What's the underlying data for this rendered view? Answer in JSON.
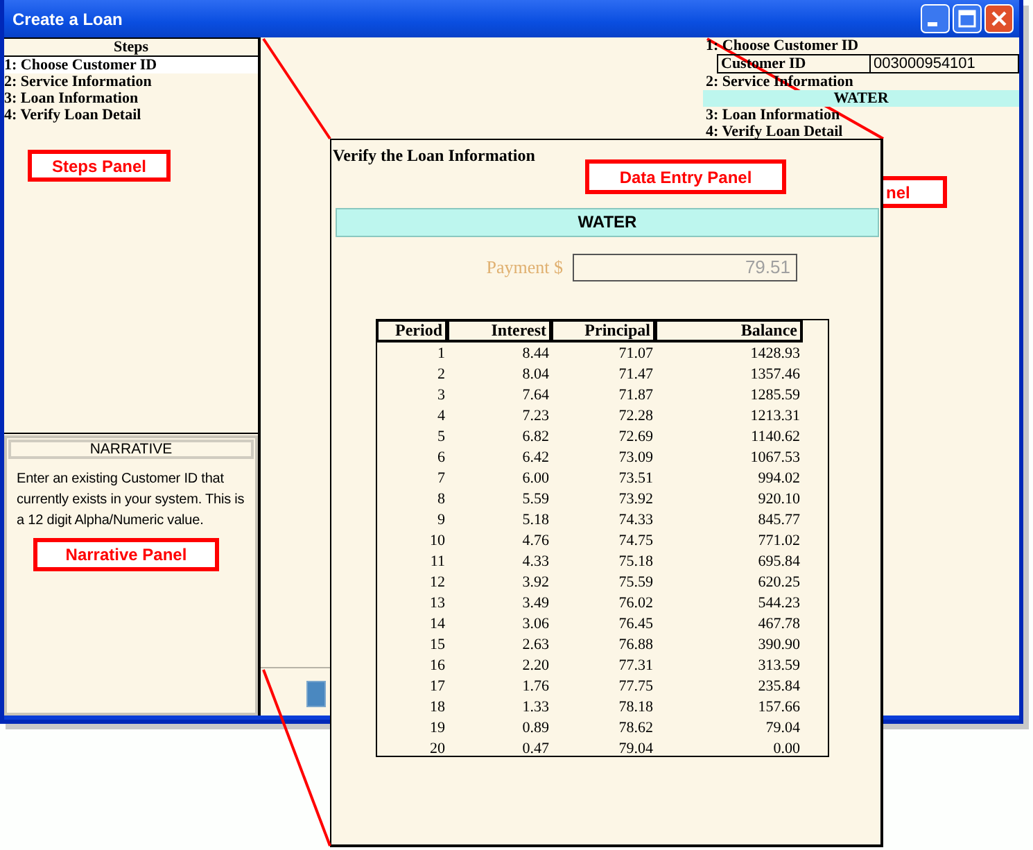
{
  "window": {
    "title": "Create a Loan"
  },
  "steps_panel": {
    "heading": "Steps",
    "steps": [
      {
        "label": "1: Choose Customer ID",
        "selected": true
      },
      {
        "label": "2: Service Information",
        "selected": false
      },
      {
        "label": "3: Loan Information",
        "selected": false
      },
      {
        "label": "4: Verify Loan Detail",
        "selected": false
      }
    ]
  },
  "narrative_panel": {
    "heading": "NARRATIVE",
    "text": "Enter an existing Customer ID that currently exists in your system. This is a 12 digit Alpha/Numeric value."
  },
  "summary_panel": {
    "items": [
      {
        "kind": "step",
        "label": "1: Choose Customer ID"
      },
      {
        "kind": "field",
        "label": "Customer ID",
        "value": "003000954101"
      },
      {
        "kind": "step",
        "label": "2: Service Information"
      },
      {
        "kind": "highlight",
        "label": "WATER"
      },
      {
        "kind": "step",
        "label": "3: Loan Information"
      },
      {
        "kind": "step",
        "label": "4: Verify Loan Detail"
      }
    ]
  },
  "data_entry_panel": {
    "title": "Verify the Loan Information",
    "service": "WATER",
    "payment": {
      "label": "Payment $",
      "value": "79.51",
      "disabled": true
    },
    "table": {
      "columns": [
        "Period",
        "Interest",
        "Principal",
        "Balance"
      ],
      "rows": [
        [
          "1",
          "8.44",
          "71.07",
          "1428.93"
        ],
        [
          "2",
          "8.04",
          "71.47",
          "1357.46"
        ],
        [
          "3",
          "7.64",
          "71.87",
          "1285.59"
        ],
        [
          "4",
          "7.23",
          "72.28",
          "1213.31"
        ],
        [
          "5",
          "6.82",
          "72.69",
          "1140.62"
        ],
        [
          "6",
          "6.42",
          "73.09",
          "1067.53"
        ],
        [
          "7",
          "6.00",
          "73.51",
          "994.02"
        ],
        [
          "8",
          "5.59",
          "73.92",
          "920.10"
        ],
        [
          "9",
          "5.18",
          "74.33",
          "845.77"
        ],
        [
          "10",
          "4.76",
          "74.75",
          "771.02"
        ],
        [
          "11",
          "4.33",
          "75.18",
          "695.84"
        ],
        [
          "12",
          "3.92",
          "75.59",
          "620.25"
        ],
        [
          "13",
          "3.49",
          "76.02",
          "544.23"
        ],
        [
          "14",
          "3.06",
          "76.45",
          "467.78"
        ],
        [
          "15",
          "2.63",
          "76.88",
          "390.90"
        ],
        [
          "16",
          "2.20",
          "77.31",
          "313.59"
        ],
        [
          "17",
          "1.76",
          "77.75",
          "235.84"
        ],
        [
          "18",
          "1.33",
          "78.18",
          "157.66"
        ],
        [
          "19",
          "0.89",
          "78.62",
          "79.04"
        ],
        [
          "20",
          "0.47",
          "79.04",
          "0.00"
        ]
      ]
    }
  },
  "callouts": [
    {
      "label": "Steps Panel"
    },
    {
      "label": "Narrative Panel"
    },
    {
      "label": "Data Entry Panel"
    },
    {
      "label": "nel"
    }
  ]
}
